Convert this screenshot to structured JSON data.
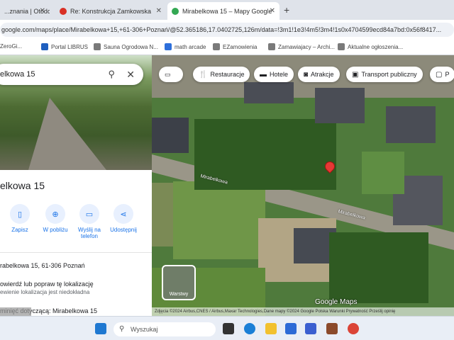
{
  "browser": {
    "tabs": [
      {
        "title": "...znania | Otodo...",
        "color": "#9aa0a6",
        "active": false
      },
      {
        "title": "Re: Konstrukcja Zamkowska",
        "color": "#d93025",
        "active": false
      },
      {
        "title": "Mirabelkowa 15 – Mapy Google",
        "color": "#34a853",
        "active": true
      }
    ],
    "new_tab": "+",
    "url": "google.com/maps/place/Mirabelkowa+15,+61-306+Poznań/@52.365186,17.0402725,126m/data=!3m1!1e3!4m5!3m4!1s0x4704599ecd84a7bd:0x56f8417...",
    "bookmarks": [
      "ZeroGi...",
      "Portal LIBRUS",
      "Sauna Ogrodowa N...",
      "math arcade",
      "EZamowienia",
      "Zamawiajacy – Archi...",
      "Aktualne ogłoszenia..."
    ]
  },
  "sidebar": {
    "search_value": "elkowa 15",
    "place_title": "elkowa 15",
    "actions": [
      {
        "label": "Zapisz",
        "icon": "bookmark-icon"
      },
      {
        "label": "W pobliżu",
        "icon": "nearby-icon"
      },
      {
        "label": "Wyślij na telefon",
        "icon": "phone-icon"
      },
      {
        "label": "Udostępnij",
        "icon": "share-icon"
      }
    ],
    "address": "rabelkowa 15, 61-306 Poznań",
    "verify": "owierdź lub popraw tę lokalizację",
    "verify_sub": "ewienie lokalizacja jest niedokładna",
    "nearby": "minięć dotyczącą: Mirabelkowa 15"
  },
  "map": {
    "chips": [
      {
        "label": "Restauracje",
        "icon": "fork-knife-icon"
      },
      {
        "label": "Hotele",
        "icon": "bed-icon"
      },
      {
        "label": "Atrakcje",
        "icon": "camera-icon"
      },
      {
        "label": "Transport publiczny",
        "icon": "bus-icon"
      },
      {
        "label": "P",
        "icon": "parking-icon"
      }
    ],
    "street_labels": [
      "Mirabelkowa",
      "Mirabelkowa"
    ],
    "layers_label": "Warstwy",
    "brand": "Google Maps",
    "attribution": "Zdjęcia ©2024 Airbus,CNES / Airbus,Maxar Technologies,Dane mapy ©2024 Google    Polska    Warunki    Prywatność    Prześlij opinię"
  },
  "taskbar": {
    "search_placeholder": "Wyszukaj"
  },
  "watermark": "o.pl"
}
